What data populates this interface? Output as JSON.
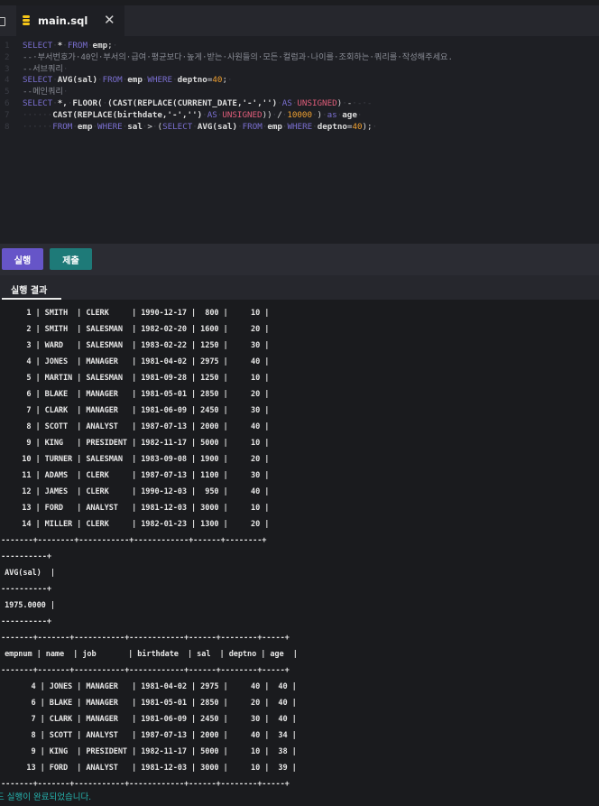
{
  "tab": {
    "filename": "main.sql",
    "close": "✕"
  },
  "editor": {
    "lines": [
      {
        "n": "1",
        "parts": [
          [
            "kw",
            "SELECT"
          ],
          [
            "ws",
            "·"
          ],
          [
            "fn",
            "*"
          ],
          [
            "ws",
            "·"
          ],
          [
            "kw",
            "FROM"
          ],
          [
            "ws",
            "·"
          ],
          [
            "fn",
            "emp"
          ],
          [
            "op",
            ";"
          ],
          [
            "ws",
            "·"
          ]
        ]
      },
      {
        "n": "2",
        "parts": [
          [
            "cm",
            "--·부서번호가·40인·부서의·급여·평균보다·높게·받는·사원들의·모든·컬럼과·나이를·조회하는·쿼리를·작성해주세요."
          ]
        ]
      },
      {
        "n": "3",
        "parts": [
          [
            "cm",
            "--서브쿼리"
          ],
          [
            "ws",
            "·"
          ]
        ]
      },
      {
        "n": "4",
        "parts": [
          [
            "kw",
            "SELECT"
          ],
          [
            "ws",
            "·"
          ],
          [
            "fn",
            "AVG(sal)"
          ],
          [
            "ws",
            "·"
          ],
          [
            "kw",
            "FROM"
          ],
          [
            "ws",
            "·"
          ],
          [
            "fn",
            "emp"
          ],
          [
            "ws",
            "·"
          ],
          [
            "kw",
            "WHERE"
          ],
          [
            "ws",
            "·"
          ],
          [
            "fn",
            "deptno"
          ],
          [
            "op",
            "="
          ],
          [
            "num",
            "40"
          ],
          [
            "op",
            ";"
          ],
          [
            "ws",
            "·"
          ]
        ]
      },
      {
        "n": "5",
        "parts": [
          [
            "cm",
            "--메인쿼리"
          ],
          [
            "ws",
            "·"
          ]
        ]
      },
      {
        "n": "6",
        "parts": [
          [
            "kw",
            "SELECT"
          ],
          [
            "ws",
            "·"
          ],
          [
            "fn",
            "*,"
          ],
          [
            "ws",
            "·"
          ],
          [
            "fn",
            "FLOOR("
          ],
          [
            "ws",
            "·"
          ],
          [
            "fn",
            "(CAST(REPLACE(CURRENT_DATE,'-','')"
          ],
          [
            "ws",
            "·"
          ],
          [
            "kw",
            "AS"
          ],
          [
            "ws",
            "·"
          ],
          [
            "kr",
            "UNSIGNED"
          ],
          [
            "op",
            ")"
          ],
          [
            "ws",
            "·"
          ],
          [
            "op",
            "-"
          ],
          [
            "ws",
            "·-·-"
          ]
        ]
      },
      {
        "n": "7",
        "parts": [
          [
            "ws",
            "······"
          ],
          [
            "fn",
            "CAST(REPLACE(birthdate,'-','')"
          ],
          [
            "ws",
            "·"
          ],
          [
            "kw",
            "AS"
          ],
          [
            "ws",
            "·"
          ],
          [
            "kr",
            "UNSIGNED"
          ],
          [
            "op",
            "))"
          ],
          [
            "ws",
            "·"
          ],
          [
            "op",
            "/"
          ],
          [
            "ws",
            "·"
          ],
          [
            "num",
            "10000"
          ],
          [
            "ws",
            "·"
          ],
          [
            "op",
            ")"
          ],
          [
            "ws",
            "·"
          ],
          [
            "kw",
            "as"
          ],
          [
            "ws",
            "·"
          ],
          [
            "fn",
            "age"
          ],
          [
            "ws",
            "·"
          ]
        ]
      },
      {
        "n": "8",
        "parts": [
          [
            "ws",
            "······"
          ],
          [
            "kw",
            "FROM"
          ],
          [
            "ws",
            "·"
          ],
          [
            "fn",
            "emp"
          ],
          [
            "ws",
            "·"
          ],
          [
            "kw",
            "WHERE"
          ],
          [
            "ws",
            "·"
          ],
          [
            "fn",
            "sal"
          ],
          [
            "ws",
            "·"
          ],
          [
            "op",
            ">"
          ],
          [
            "ws",
            "·"
          ],
          [
            "op",
            "("
          ],
          [
            "kw",
            "SELECT"
          ],
          [
            "ws",
            "·"
          ],
          [
            "fn",
            "AVG(sal)"
          ],
          [
            "ws",
            "·"
          ],
          [
            "kw",
            "FROM"
          ],
          [
            "ws",
            "·"
          ],
          [
            "fn",
            "emp"
          ],
          [
            "ws",
            "·"
          ],
          [
            "kw",
            "WHERE"
          ],
          [
            "ws",
            "·"
          ],
          [
            "fn",
            "deptno"
          ],
          [
            "op",
            "="
          ],
          [
            "num",
            "40"
          ],
          [
            "op",
            ");"
          ],
          [
            "ws",
            "·"
          ]
        ]
      }
    ]
  },
  "toolbar": {
    "run_label": "실행",
    "submit_label": "제출"
  },
  "results": {
    "tab_label": "실행 결과",
    "lines": [
      "     1 | SMITH  | CLERK     | 1990-12-17 |  800 |     10 |",
      "     2 | SMITH  | SALESMAN  | 1982-02-20 | 1600 |     20 |",
      "     3 | WARD   | SALESMAN  | 1983-02-22 | 1250 |     30 |",
      "     4 | JONES  | MANAGER   | 1981-04-02 | 2975 |     40 |",
      "     5 | MARTIN | SALESMAN  | 1981-09-28 | 1250 |     10 |",
      "     6 | BLAKE  | MANAGER   | 1981-05-01 | 2850 |     20 |",
      "     7 | CLARK  | MANAGER   | 1981-06-09 | 2450 |     30 |",
      "     8 | SCOTT  | ANALYST   | 1987-07-13 | 2000 |     40 |",
      "     9 | KING   | PRESIDENT | 1982-11-17 | 5000 |     10 |",
      "    10 | TURNER | SALESMAN  | 1983-09-08 | 1900 |     20 |",
      "    11 | ADAMS  | CLERK     | 1987-07-13 | 1100 |     30 |",
      "    12 | JAMES  | CLERK     | 1990-12-03 |  950 |     40 |",
      "    13 | FORD   | ANALYST   | 1981-12-03 | 3000 |     10 |",
      "    14 | MILLER | CLERK     | 1982-01-23 | 1300 |     20 |",
      "--------+--------+-----------+------------+------+--------+",
      "-----------+",
      " AVG(sal)  |",
      "-----------+",
      " 1975.0000 |",
      "-----------+",
      "--------+-------+-----------+------------+------+--------+-----+",
      " empnum | name  | job       | birthdate  | sal  | deptno | age  |",
      "--------+-------+-----------+------------+------+--------+-----+",
      "      4 | JONES | MANAGER   | 1981-04-02 | 2975 |     40 |  40 |",
      "      6 | BLAKE | MANAGER   | 1981-05-01 | 2850 |     20 |  40 |",
      "      7 | CLARK | MANAGER   | 1981-06-09 | 2450 |     30 |  40 |",
      "      8 | SCOTT | ANALYST   | 1987-07-13 | 2000 |     40 |  34 |",
      "      9 | KING  | PRESIDENT | 1982-11-17 | 5000 |     10 |  38 |",
      "     13 | FORD  | ANALYST   | 1981-12-03 | 3000 |     10 |  39 |",
      "--------+-------+-----------+------------+------+--------+-----+"
    ],
    "status": "드 실행이 완료되었습니다."
  }
}
